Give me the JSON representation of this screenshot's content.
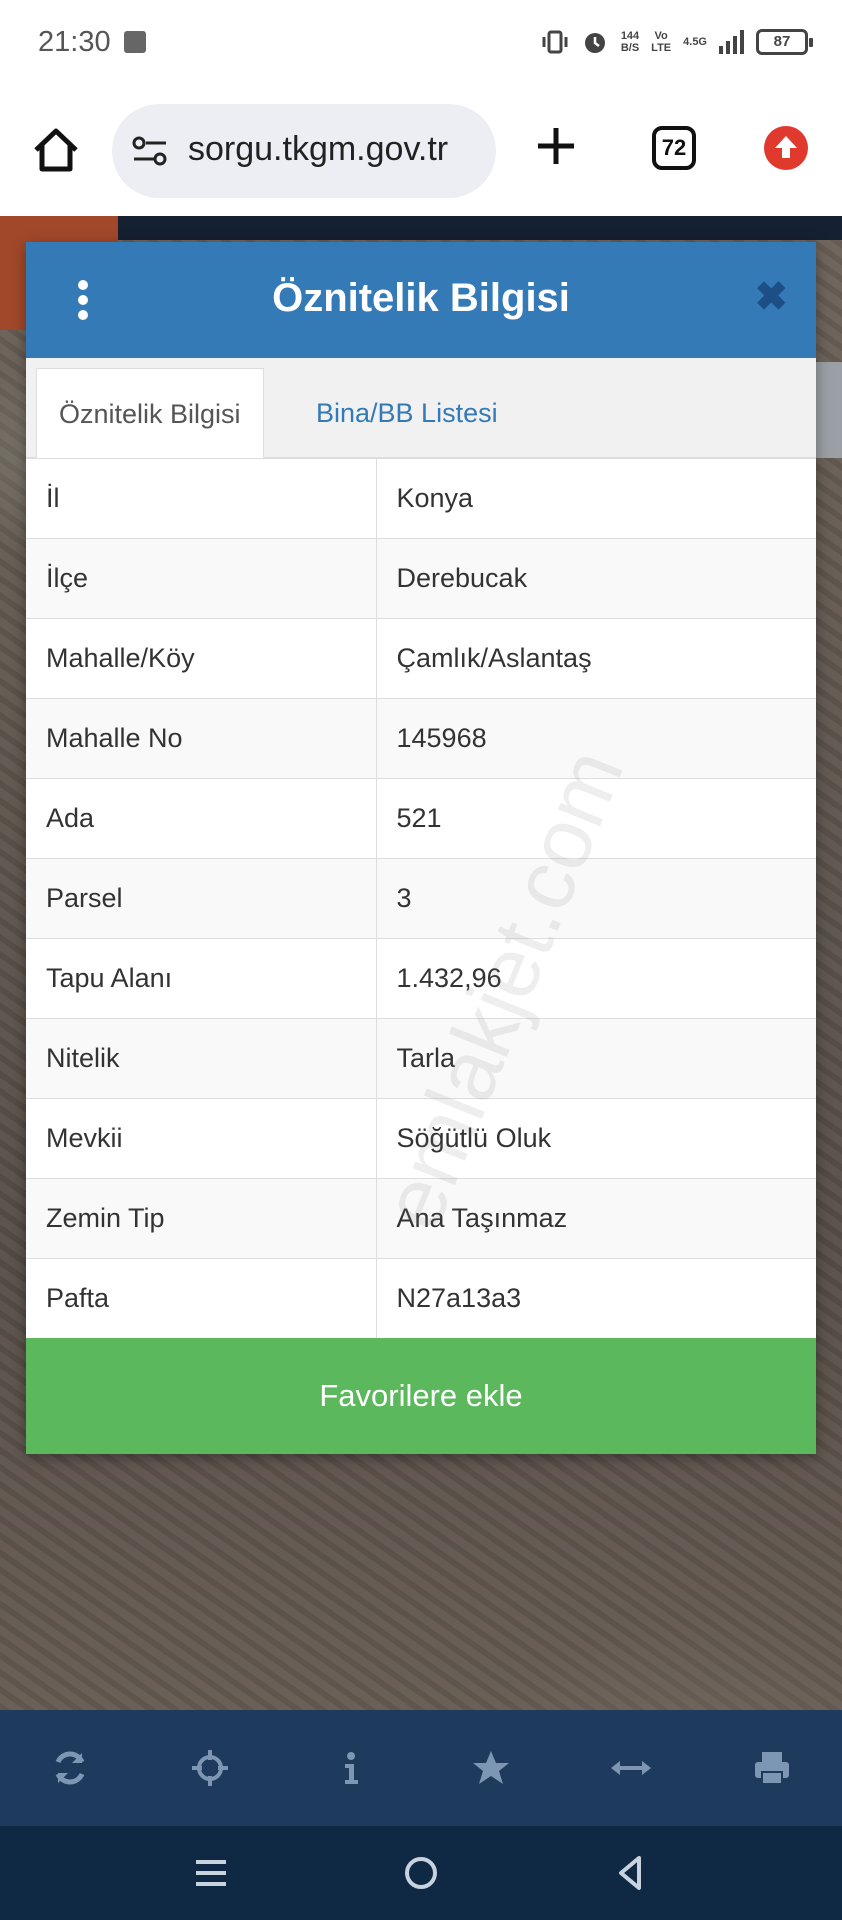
{
  "status_bar": {
    "time": "21:30",
    "data_rate_top": "144",
    "data_rate_bottom": "B/S",
    "volte_top": "Vo",
    "volte_bottom": "LTE",
    "network": "4.5G",
    "battery": "87"
  },
  "browser": {
    "url": "sorgu.tkgm.gov.tr",
    "tab_count": "72"
  },
  "modal": {
    "title": "Öznitelik Bilgisi",
    "tabs": [
      {
        "label": "Öznitelik Bilgisi",
        "active": true
      },
      {
        "label": "Bina/BB Listesi",
        "active": false
      }
    ],
    "rows": [
      {
        "key": "İl",
        "value": "Konya"
      },
      {
        "key": "İlçe",
        "value": "Derebucak"
      },
      {
        "key": "Mahalle/Köy",
        "value": "Çamlık/Aslantaş"
      },
      {
        "key": "Mahalle No",
        "value": "145968"
      },
      {
        "key": "Ada",
        "value": "521"
      },
      {
        "key": "Parsel",
        "value": "3"
      },
      {
        "key": "Tapu Alanı",
        "value": "1.432,96"
      },
      {
        "key": "Nitelik",
        "value": "Tarla"
      },
      {
        "key": "Mevkii",
        "value": "Söğütlü Oluk"
      },
      {
        "key": "Zemin Tip",
        "value": "Ana Taşınmaz"
      },
      {
        "key": "Pafta",
        "value": "N27a13a3"
      }
    ],
    "favorite_button": "Favorilere ekle"
  },
  "watermark": "emlakjet.com",
  "toolbar": {
    "icons": [
      "refresh-icon",
      "crosshair-icon",
      "info-icon",
      "star-icon",
      "measure-icon",
      "print-icon"
    ]
  },
  "colors": {
    "header_blue": "#337ab7",
    "favorite_green": "#5cb85c",
    "toolbar_bg": "#1e3a5c",
    "nav_bg": "#0f2844"
  }
}
